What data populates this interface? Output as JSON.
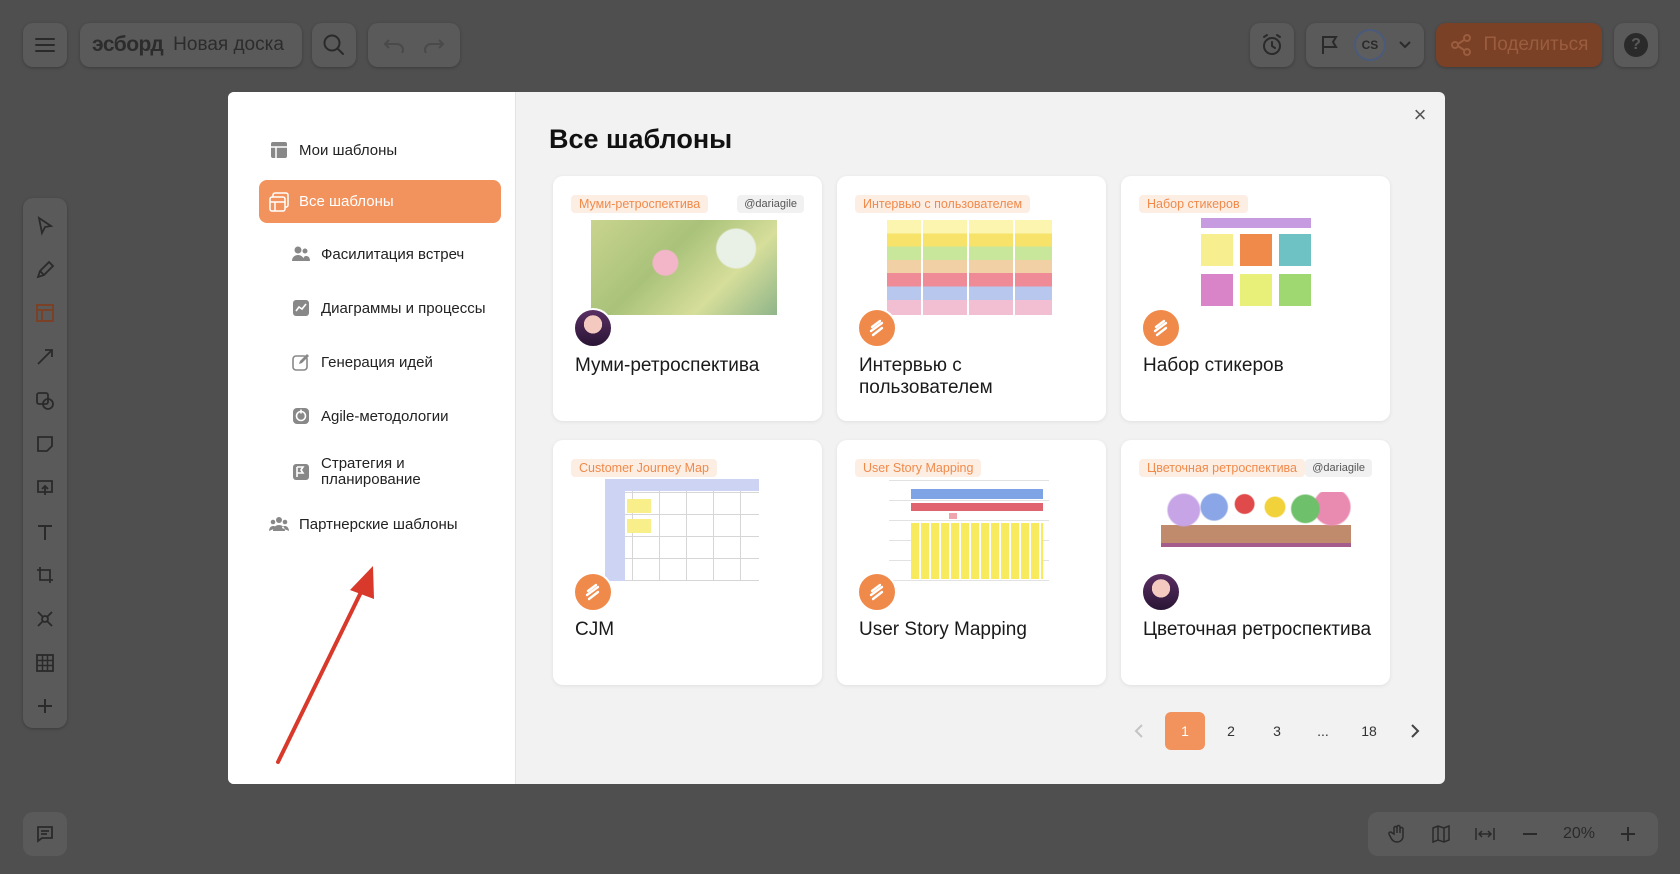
{
  "header": {
    "logo": "эсборд",
    "board_name": "Новая доска",
    "user_initials": "CS",
    "share_label": "Поделиться",
    "help_label": "?"
  },
  "zoom": {
    "value": "20%"
  },
  "sidebar": {
    "items": [
      {
        "label": "Мои шаблоны"
      },
      {
        "label": "Все шаблоны"
      },
      {
        "label": "Фасилитация встреч"
      },
      {
        "label": "Диаграммы и процессы"
      },
      {
        "label": "Генерация идей"
      },
      {
        "label": "Agile-методологии"
      },
      {
        "label": "Стратегия и планирование"
      },
      {
        "label": "Партнерские шаблоны"
      }
    ]
  },
  "main": {
    "title": "Все шаблоны",
    "close": "×",
    "cards": [
      {
        "tag": "Муми-ретроспектива",
        "author": "@dariagile",
        "name": "Муми-ретроспектива"
      },
      {
        "tag": "Интервью с пользователем",
        "author": "",
        "name": "Интервью с пользователем"
      },
      {
        "tag": "Набор стикеров",
        "author": "",
        "name": "Набор стикеров"
      },
      {
        "tag": "Customer Journey Map",
        "author": "",
        "name": "CJM"
      },
      {
        "tag": "User Story Mapping",
        "author": "",
        "name": "User Story Mapping"
      },
      {
        "tag": "Цветочная ретроспектива",
        "author": "@dariagile",
        "name": "Цветочная ретроспектива"
      }
    ]
  },
  "pagination": {
    "pages": [
      "1",
      "2",
      "3",
      "...",
      "18"
    ],
    "current": "1"
  },
  "colors": {
    "accent": "#f2935e",
    "overlay": "#4f4f4f",
    "arrow": "#d9392a"
  }
}
